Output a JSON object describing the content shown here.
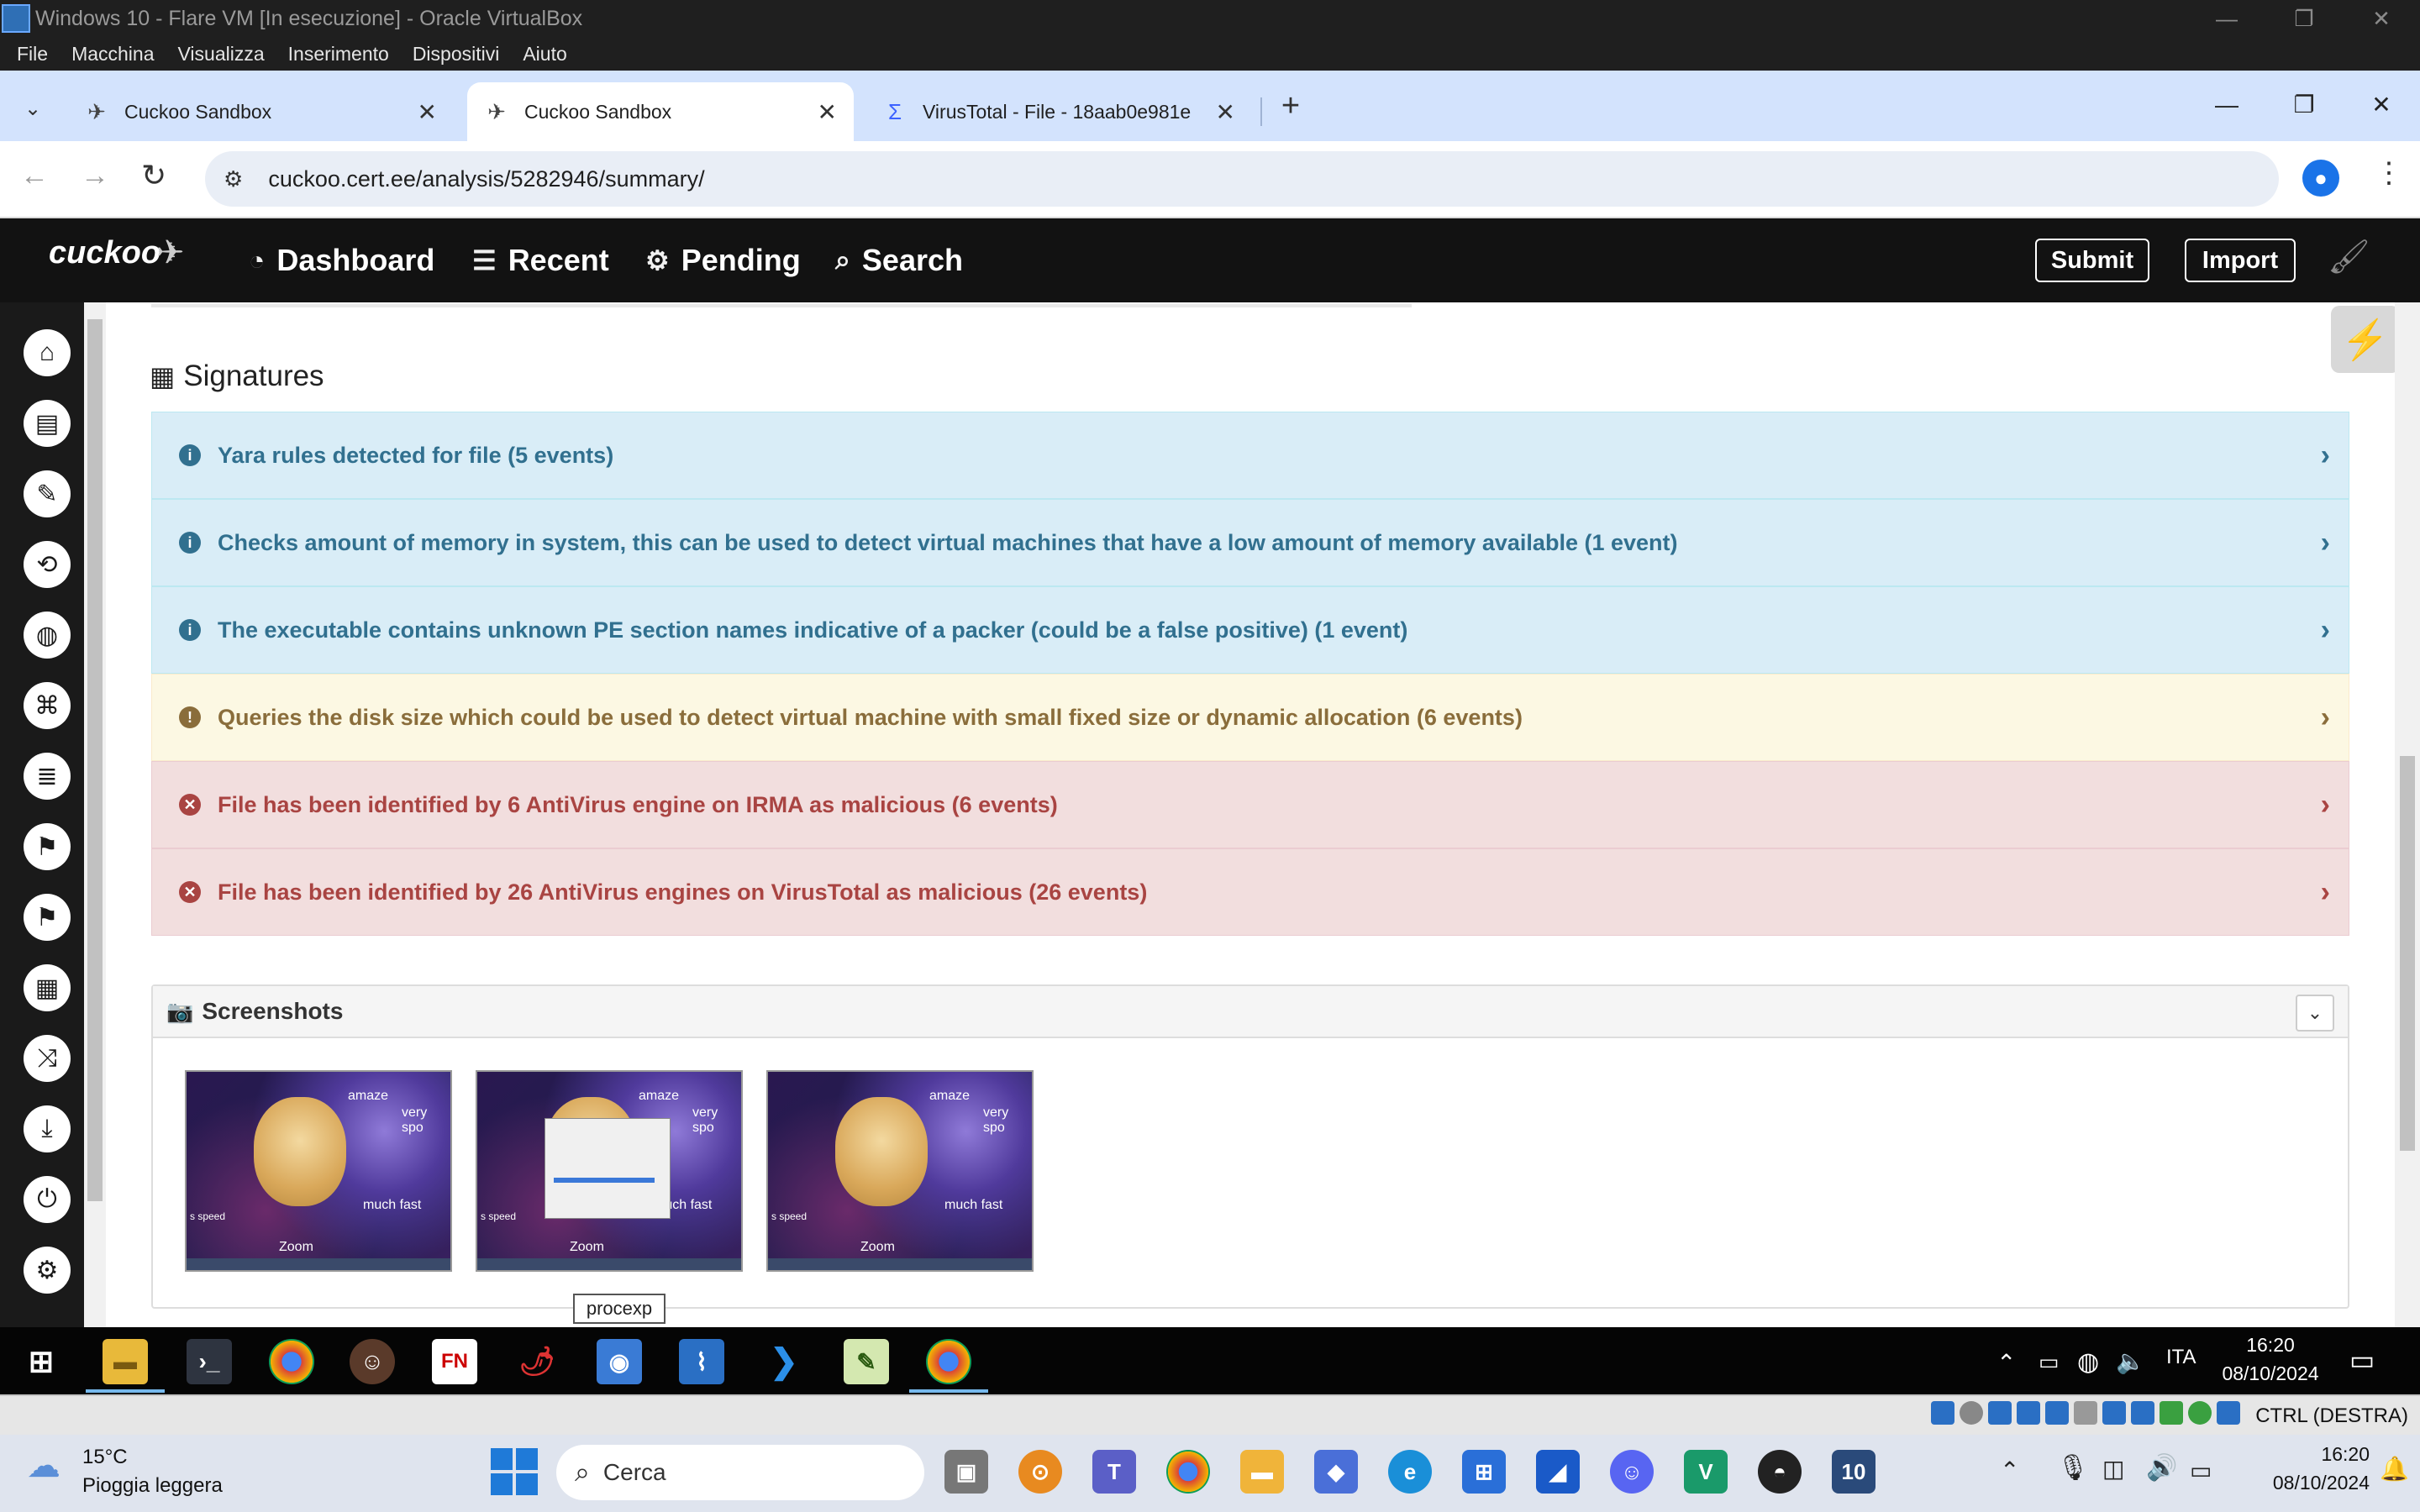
{
  "vbox": {
    "title": "Windows 10 - Flare VM [In esecuzione] - Oracle VirtualBox",
    "menu": [
      "File",
      "Macchina",
      "Visualizza",
      "Inserimento",
      "Dispositivi",
      "Aiuto"
    ]
  },
  "browser": {
    "tabs": [
      {
        "label": "Cuckoo Sandbox",
        "icon": "cuckoo-bird-icon"
      },
      {
        "label": "Cuckoo Sandbox",
        "icon": "cuckoo-bird-icon"
      },
      {
        "label": "VirusTotal - File - 18aab0e981e",
        "icon": "virustotal-icon"
      }
    ],
    "url": "cuckoo.cert.ee/analysis/5282946/summary/"
  },
  "cuckoo_nav": {
    "logo": "cuckoo",
    "items": [
      "Dashboard",
      "Recent",
      "Pending",
      "Search"
    ],
    "submit": "Submit",
    "import": "Import"
  },
  "signatures": {
    "title": "Signatures",
    "rows": [
      {
        "text": "Yara rules detected for file (5 events)",
        "severity": "info"
      },
      {
        "text": "Checks amount of memory in system, this can be used to detect virtual machines that have a low amount of memory available (1 event)",
        "severity": "info"
      },
      {
        "text": "The executable contains unknown PE section names indicative of a packer (could be a false positive) (1 event)",
        "severity": "info"
      },
      {
        "text": "Queries the disk size which could be used to detect virtual machine with small fixed size or dynamic allocation (6 events)",
        "severity": "warning"
      },
      {
        "text": "File has been identified by 6 AntiVirus engine on IRMA as malicious (6 events)",
        "severity": "danger"
      },
      {
        "text": "File has been identified by 26 AntiVirus engines on VirusTotal as malicious (26 events)",
        "severity": "danger"
      }
    ]
  },
  "screenshots": {
    "title": "Screenshots",
    "thumb_texts": {
      "amaze": "amaze",
      "very": "very spo",
      "much": "much fast",
      "zoom": "Zoom",
      "speed": "s speed"
    }
  },
  "tooltip": "procexp",
  "guest_tray": {
    "lang": "ITA",
    "time": "16:20",
    "date": "08/10/2024"
  },
  "vbox_status": {
    "host_key": "CTRL (DESTRA)"
  },
  "host": {
    "weather_temp": "15°C",
    "weather_desc": "Pioggia leggera",
    "search": "Cerca",
    "time": "16:20",
    "date": "08/10/2024"
  }
}
